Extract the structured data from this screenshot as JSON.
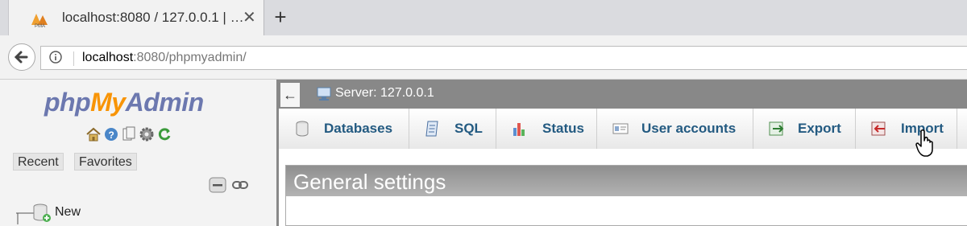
{
  "browser": {
    "tab": {
      "title": "localhost:8080 / 127.0.0.1 | …",
      "favicon_icon": "phpmyadmin-favicon",
      "close_icon": "close-icon"
    },
    "new_tab_icon": "plus-icon",
    "back_icon": "back-arrow-icon",
    "info_icon": "info-icon",
    "url": {
      "host": "localhost",
      "rest": ":8080/phpmyadmin/"
    }
  },
  "nav": {
    "logo": {
      "php": "php",
      "my": "My",
      "admin": "Admin"
    },
    "icons": [
      "home-icon",
      "help-icon",
      "docs-icon",
      "settings-icon",
      "reload-icon"
    ],
    "tabs": [
      "Recent",
      "Favorites"
    ],
    "collapse_all_icon": "collapse-all-icon",
    "link_icon": "link-icon",
    "tree": [
      {
        "label": "New",
        "icon": "new-database-icon"
      }
    ]
  },
  "main": {
    "collapse_arrow": "←",
    "server": {
      "icon": "server-icon",
      "label": "Server: 127.0.0.1"
    },
    "menu": [
      {
        "label": "Databases",
        "icon": "database-icon"
      },
      {
        "label": "SQL",
        "icon": "sql-icon"
      },
      {
        "label": "Status",
        "icon": "status-chart-icon"
      },
      {
        "label": "User accounts",
        "icon": "user-accounts-icon"
      },
      {
        "label": "Export",
        "icon": "export-icon"
      },
      {
        "label": "Import",
        "icon": "import-icon"
      }
    ],
    "general_settings": {
      "title": "General settings"
    }
  },
  "colors": {
    "link": "#235a81",
    "logo_blue": "#6c78af",
    "logo_orange": "#f89406",
    "server_bar": "#888888"
  }
}
